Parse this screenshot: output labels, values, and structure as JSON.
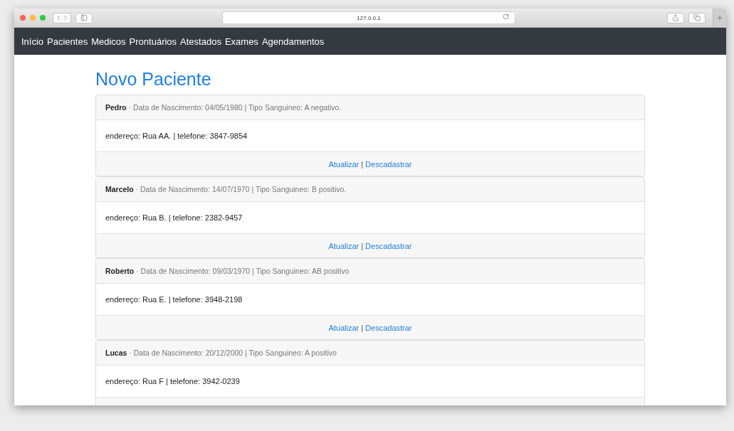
{
  "browser": {
    "url": "127.0.0.1"
  },
  "nav": {
    "items": [
      {
        "label": "Início"
      },
      {
        "label": "Pacientes"
      },
      {
        "label": "Medicos"
      },
      {
        "label": "Prontuários"
      },
      {
        "label": "Atestados"
      },
      {
        "label": "Exames"
      },
      {
        "label": "Agendamentos"
      }
    ]
  },
  "heading": "Novo Paciente",
  "patients": [
    {
      "name": "Pedro",
      "details": " · Data de Nascimento: 04/05/1980 | Tipo Sanguineo: A negativo.",
      "contact": "endereço: Rua AA. | telefone: 3847-9854",
      "actions": {
        "update": "Atualizar",
        "separator": "|",
        "remove": "Descadastrar"
      }
    },
    {
      "name": "Marcelo",
      "details": " · Data de Nascimento: 14/07/1970 | Tipo Sanguineo: B positivo.",
      "contact": "endereço: Rua B. | telefone: 2382-9457",
      "actions": {
        "update": "Atualizar",
        "separator": "|",
        "remove": "Descadastrar"
      }
    },
    {
      "name": "Roberto",
      "details": " · Data de Nascimento: 09/03/1970 | Tipo Sanguineo: AB positivo",
      "contact": "endereço: Rua E. | telefone: 3948-2198",
      "actions": {
        "update": "Atualizar",
        "separator": "|",
        "remove": "Descadastrar"
      }
    },
    {
      "name": "Lucas",
      "details": " · Data de Nascimento: 20/12/2000 | Tipo Sanguineo: A positivo",
      "contact": "endereço: Rua F | telefone: 3942-0239"
    }
  ]
}
